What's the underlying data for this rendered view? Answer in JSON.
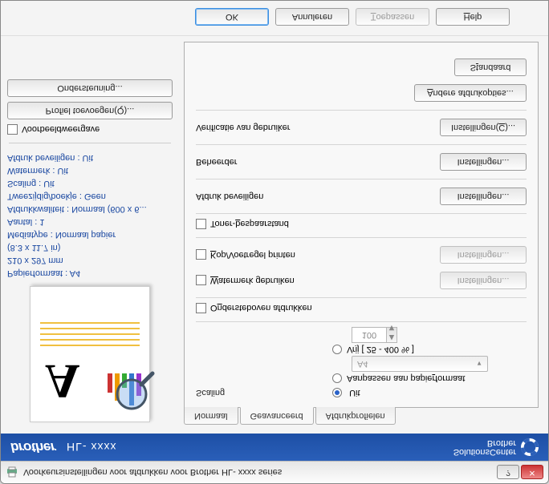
{
  "window": {
    "title": "Voorkeursinstellingen voor afdrukken voor Brother HL- xxxx series"
  },
  "brand": {
    "logo": "brother",
    "model": "HL- xxxx",
    "solutions_line1": "SolutionsCenter",
    "solutions_line2": "Brother"
  },
  "preview_info": {
    "line1": "Papierformaat : A4",
    "line2": "210 x 297 mm",
    "line3": "(8.3 x 11.7 in)",
    "line4": "Mediatype : Normaal papier",
    "line5": "Aantal : 1",
    "line6": "Afdrukkwaliteit : Normaal (600 x 6...",
    "line7": "Tweezijdig/boekje : Geen",
    "line8": "Scaling : Uit",
    "line9": "Watermerk : Uit",
    "line10": "Afdruk beveiligen : Uit"
  },
  "preview_checkbox": "Voorbeeldweergave",
  "left_buttons": {
    "add_profile": "Profiel toevoegen(Q)...",
    "support": "Ondersteuning..."
  },
  "tabs": {
    "t1": "Normaal",
    "t2": "Geavanceerd",
    "t3": "Afdrukprofielen"
  },
  "scaling": {
    "label": "Scaling",
    "opt_off_pre": "U",
    "opt_off_post": "it",
    "opt_fit_pre": "Aanpassen aan papie",
    "opt_fit_u": "r",
    "opt_fit_post": "formaat",
    "fit_dropdown": "A4",
    "opt_free_pre": "Vr",
    "opt_free_u": "ij",
    "opt_free_post": " [ 25 - 400 % ]",
    "free_value": "100"
  },
  "checks": {
    "reverse_pre": "O",
    "reverse_u": "n",
    "reverse_post": "dersteboven afdrukken",
    "watermark_pre": "",
    "watermark_u": "W",
    "watermark_post": "atermerk gebruiken",
    "headerfooter_pre": "",
    "headerfooter_u": "K",
    "headerfooter_post": "op/Voetregel printen",
    "toner_pre": "Toner-",
    "toner_u": "b",
    "toner_post": "espaarstand"
  },
  "sections": {
    "secure_print": "Afdruk beveiligen",
    "admin": "Beheerder",
    "user_auth": "Verificatie van gebruiker"
  },
  "buttons": {
    "settings_generic": "Instellingen...",
    "settings_c_pre": "Instellingen(",
    "settings_c_u": "C",
    "settings_c_post": ")...",
    "other_print_pre": "",
    "other_print_u": "A",
    "other_print_post": "ndere afdrukopties...",
    "defaults_pre": "S",
    "defaults_u": "t",
    "defaults_post": "andaard"
  },
  "bottom": {
    "ok": "OK",
    "cancel": "Annuleren",
    "apply_pre": "",
    "apply_u": "T",
    "apply_post": "oepassen",
    "help_pre": "",
    "help_u": "H",
    "help_post": "elp"
  }
}
